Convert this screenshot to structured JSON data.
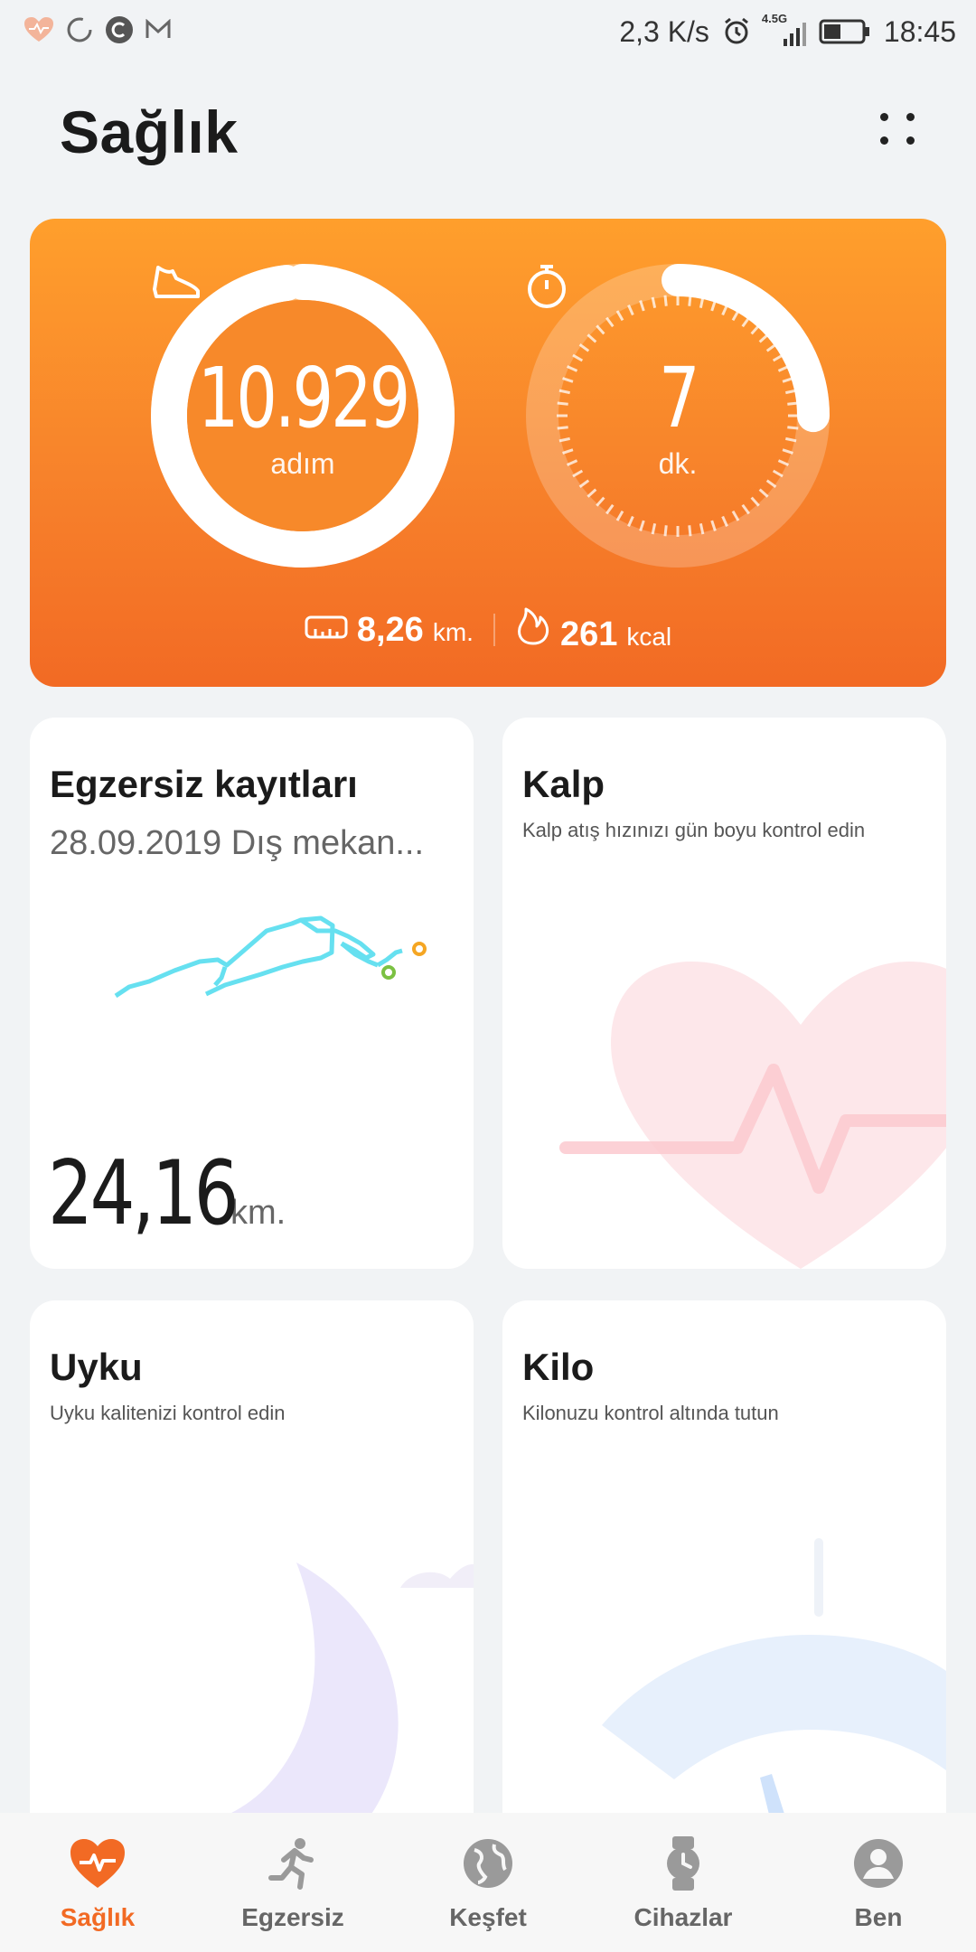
{
  "status_bar": {
    "network_speed": "2,3 K/s",
    "network_type": "4.5G",
    "time": "18:45",
    "battery_level": 0.45,
    "icons": [
      "health-heart-icon",
      "sync-ring-icon",
      "c-app-icon",
      "mail-icon",
      "alarm-icon",
      "signal-icon",
      "battery-icon"
    ]
  },
  "header": {
    "title": "Sağlık",
    "more_icon": "more-dots-icon"
  },
  "activity": {
    "steps": {
      "value": "10.929",
      "unit": "adım",
      "icon": "shoe-icon",
      "progress": 0.98
    },
    "active_time": {
      "value": "7",
      "unit": "dk.",
      "icon": "stopwatch-icon",
      "progress": 0.25
    },
    "distance": {
      "value": "8,26",
      "unit": "km.",
      "icon": "ruler-icon"
    },
    "calories": {
      "value": "261",
      "unit": "kcal",
      "icon": "flame-icon"
    }
  },
  "cards": {
    "exercise": {
      "title": "Egzersiz kayıtları",
      "subtitle": "28.09.2019 Dış mekan...",
      "distance_value": "24,16",
      "distance_unit": "km.",
      "route_color": "#66e0f0"
    },
    "heart": {
      "title": "Kalp",
      "subtitle": "Kalp atış hızınızı gün boyu kontrol edin"
    },
    "sleep": {
      "title": "Uyku",
      "subtitle": "Uyku kalitenizi kontrol edin"
    },
    "weight": {
      "title": "Kilo",
      "subtitle": "Kilonuzu kontrol altında tutun"
    }
  },
  "bottom_nav": {
    "items": [
      {
        "label": "Sağlık",
        "icon": "heart-pulse-icon",
        "active": true
      },
      {
        "label": "Egzersiz",
        "icon": "runner-icon",
        "active": false
      },
      {
        "label": "Keşfet",
        "icon": "globe-icon",
        "active": false
      },
      {
        "label": "Cihazlar",
        "icon": "watch-icon",
        "active": false
      },
      {
        "label": "Ben",
        "icon": "user-icon",
        "active": false
      }
    ]
  },
  "colors": {
    "accent": "#f26a24",
    "card_gradient_top": "#ff9f2c",
    "card_gradient_bottom": "#f26a24",
    "page_background": "#f1f3f5"
  }
}
